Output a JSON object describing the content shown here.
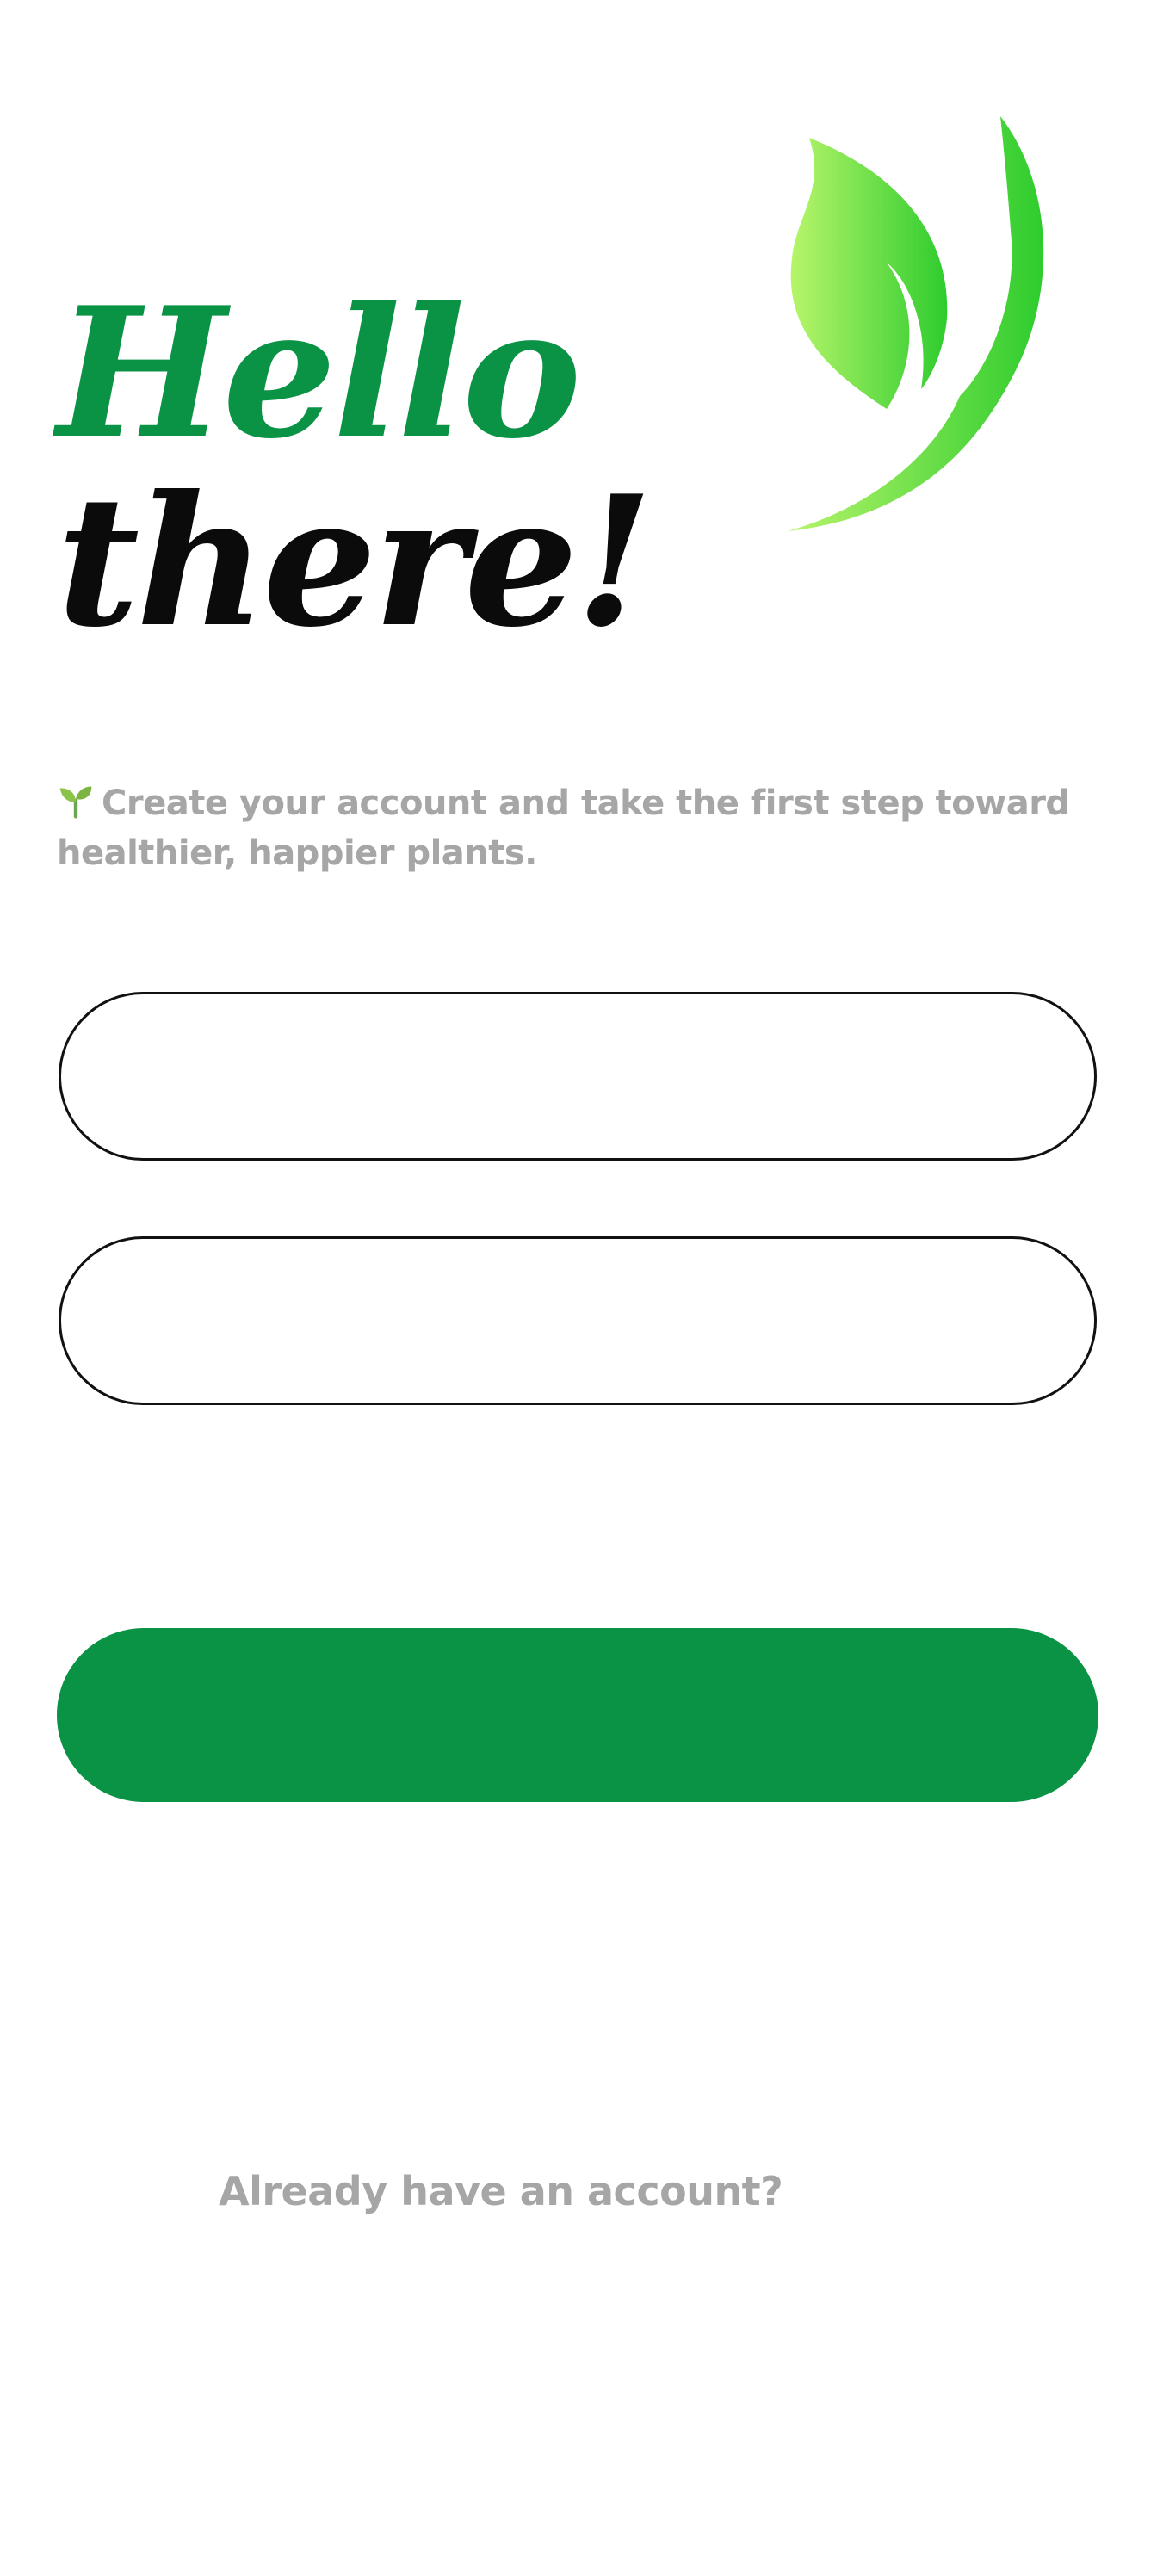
{
  "brand": {
    "logo_icon": "leaf-icon",
    "accent_color": "#0a9345",
    "leaf_gradient": [
      "#b7f56a",
      "#2ecc2e"
    ]
  },
  "hero": {
    "line1": "Hello",
    "line2": "there!"
  },
  "intro": {
    "icon": "sprout-icon",
    "text": "Create your account and take the first step toward healthier, happier plants."
  },
  "form": {
    "field_1": {
      "value": "",
      "placeholder": ""
    },
    "field_2": {
      "value": "",
      "placeholder": ""
    },
    "submit_label": ""
  },
  "footer": {
    "login_prompt": "Already have an account?"
  }
}
